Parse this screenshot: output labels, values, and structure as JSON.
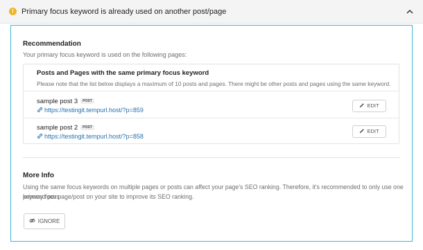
{
  "header": {
    "title": "Primary focus keyword is already used on another post/page",
    "icon": "warning-icon",
    "collapse_icon": "chevron-up-icon"
  },
  "recommendation": {
    "title": "Recommendation",
    "description": "Your primary focus keyword is used on the following pages:"
  },
  "list": {
    "title": "Posts and Pages with the same primary focus keyword",
    "note": "Please note that the list below displays a maximum of 10 posts and pages. There might be other posts and pages using the same keyword.",
    "items": [
      {
        "title": "sample post 3",
        "badge": "POST",
        "url": "https://testingit.tempurl.host/?p=859",
        "edit_label": "EDIT"
      },
      {
        "title": "sample post 2",
        "badge": "POST",
        "url": "https://testingit.tempurl.host/?p=858",
        "edit_label": "EDIT"
      }
    ]
  },
  "more_info": {
    "title": "More Info",
    "text_line1": "Using the same focus keywords on multiple pages or posts can affect your page's SEO ranking. Therefore, it's recommended to only use one primary focus",
    "text_line2": "keyword per page/post on your site to improve its SEO ranking."
  },
  "ignore": {
    "label": "IGNORE"
  },
  "colors": {
    "accent_border": "#3fb6d5",
    "warning": "#f0b429",
    "link": "#2271b1",
    "header_bg": "#f4f4f4"
  }
}
